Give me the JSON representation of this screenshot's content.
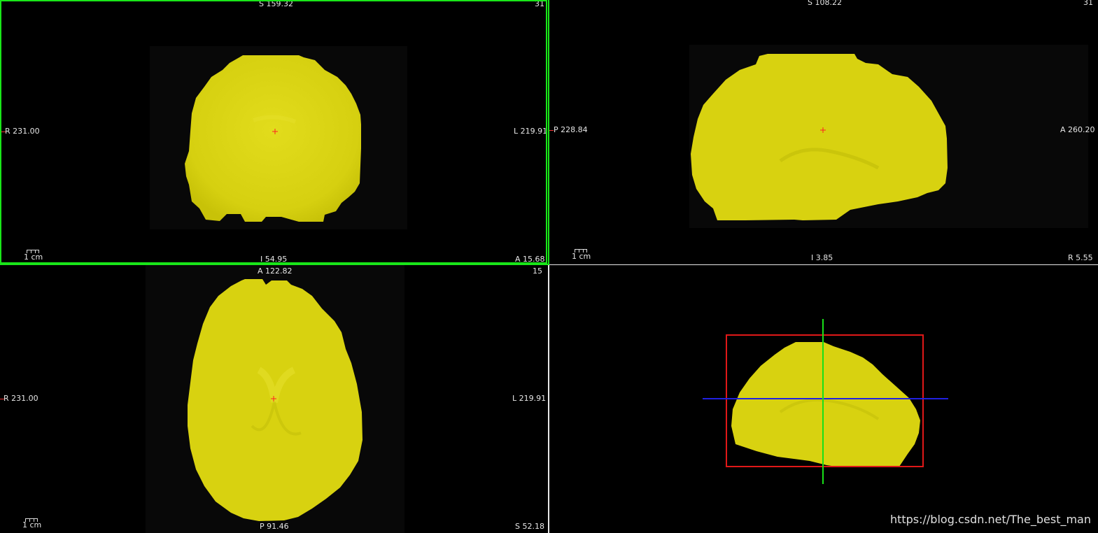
{
  "viewer": {
    "coronal": {
      "top": "S 159.32",
      "bottom": "I 54.95",
      "left": "R 231.00",
      "right": "L 219.91",
      "slice": "31",
      "corner": "A 15.68",
      "scale": "1 cm"
    },
    "sagittal": {
      "top": "S 108.22",
      "bottom": "I 3.85",
      "left": "P 228.84",
      "right": "A 260.20",
      "slice": "31",
      "corner": "R 5.55",
      "scale": "1 cm"
    },
    "axial": {
      "top": "A 122.82",
      "bottom": "P 91.46",
      "left": "R 231.00",
      "right": "L 219.91",
      "slice": "15",
      "corner": "S 52.18",
      "scale": "1 cm"
    }
  },
  "colors": {
    "brain": "#d8d210",
    "active_border": "#19e619",
    "crosshair": "#ff2020",
    "box": "#e01818",
    "line_vertical": "#18e018",
    "line_horizontal": "#2020e0"
  },
  "watermark": "https://blog.csdn.net/The_best_man"
}
